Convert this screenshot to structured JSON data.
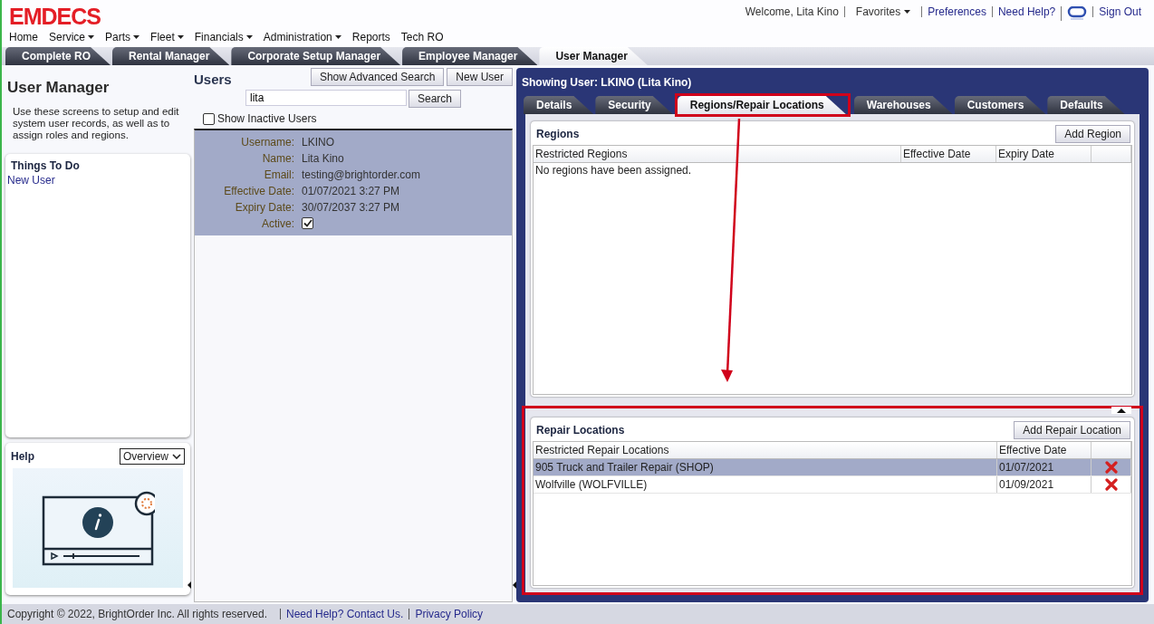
{
  "header": {
    "logo": "EMDECS",
    "welcome": "Welcome, Lita Kino",
    "favorites": "Favorites",
    "links": [
      "Preferences",
      "Need Help?",
      "Sign Out"
    ]
  },
  "menu": [
    {
      "label": "Home",
      "dropdown": false
    },
    {
      "label": "Service",
      "dropdown": true
    },
    {
      "label": "Parts",
      "dropdown": true
    },
    {
      "label": "Fleet",
      "dropdown": true
    },
    {
      "label": "Financials",
      "dropdown": true
    },
    {
      "label": "Administration",
      "dropdown": true
    },
    {
      "label": "Reports",
      "dropdown": false
    },
    {
      "label": "Tech RO",
      "dropdown": false
    }
  ],
  "module_tabs": [
    {
      "label": "Complete RO",
      "selected": false
    },
    {
      "label": "Rental Manager",
      "selected": false
    },
    {
      "label": "Corporate Setup Manager",
      "selected": false
    },
    {
      "label": "Employee Manager",
      "selected": false
    },
    {
      "label": "User Manager",
      "selected": true
    }
  ],
  "sidebar": {
    "title": "User Manager",
    "description": "Use these screens to setup and edit system user records, as well as to assign roles and regions.",
    "todo": {
      "title": "Things To Do",
      "items": [
        "New User"
      ]
    },
    "help": {
      "title": "Help",
      "select": "Overview"
    }
  },
  "users": {
    "title": "Users",
    "buttons": [
      "Show Advanced Search",
      "New User"
    ],
    "search": {
      "value": "lita",
      "button": "Search"
    },
    "show_inactive": {
      "label": "Show Inactive Users",
      "checked": false
    },
    "record": {
      "selected": true,
      "fields": [
        {
          "label": "Username:",
          "value": "LKINO"
        },
        {
          "label": "Name:",
          "value": "Lita Kino"
        },
        {
          "label": "Email:",
          "value": "testing@brightorder.com"
        },
        {
          "label": "Effective Date:",
          "value": "01/07/2021 3:27 PM"
        },
        {
          "label": "Expiry Date:",
          "value": "30/07/2037 3:27 PM"
        }
      ],
      "active": {
        "label": "Active:",
        "checked": true
      }
    }
  },
  "detail": {
    "heading": "Showing User: LKINO (Lita Kino)",
    "tabs": [
      {
        "label": "Details",
        "selected": false,
        "highlighted": false
      },
      {
        "label": "Security",
        "selected": false,
        "highlighted": false
      },
      {
        "label": "Regions/Repair Locations",
        "selected": true,
        "highlighted": true
      },
      {
        "label": "Warehouses",
        "selected": false,
        "highlighted": false
      },
      {
        "label": "Customers",
        "selected": false,
        "highlighted": false
      },
      {
        "label": "Defaults",
        "selected": false,
        "highlighted": false
      }
    ],
    "regions": {
      "title": "Regions",
      "button": "Add Region",
      "columns": [
        "Restricted Regions",
        "Effective Date",
        "Expiry Date"
      ],
      "empty": "No regions have been assigned."
    },
    "repair_locations": {
      "title": "Repair Locations",
      "button": "Add Repair Location",
      "highlighted": true,
      "columns": [
        "Restricted Repair Locations",
        "Effective Date"
      ],
      "rows": [
        {
          "name": "905 Truck and Trailer Repair (SHOP)",
          "date": "01/07/2021",
          "selected": true
        },
        {
          "name": "Wolfville (WOLFVILLE)",
          "date": "01/09/2021",
          "selected": false
        }
      ]
    }
  },
  "footer": {
    "copyright": "Copyright © 2022, BrightOrder Inc. All rights reserved.",
    "links": [
      "Need Help? Contact Us.",
      "Privacy Policy"
    ]
  }
}
